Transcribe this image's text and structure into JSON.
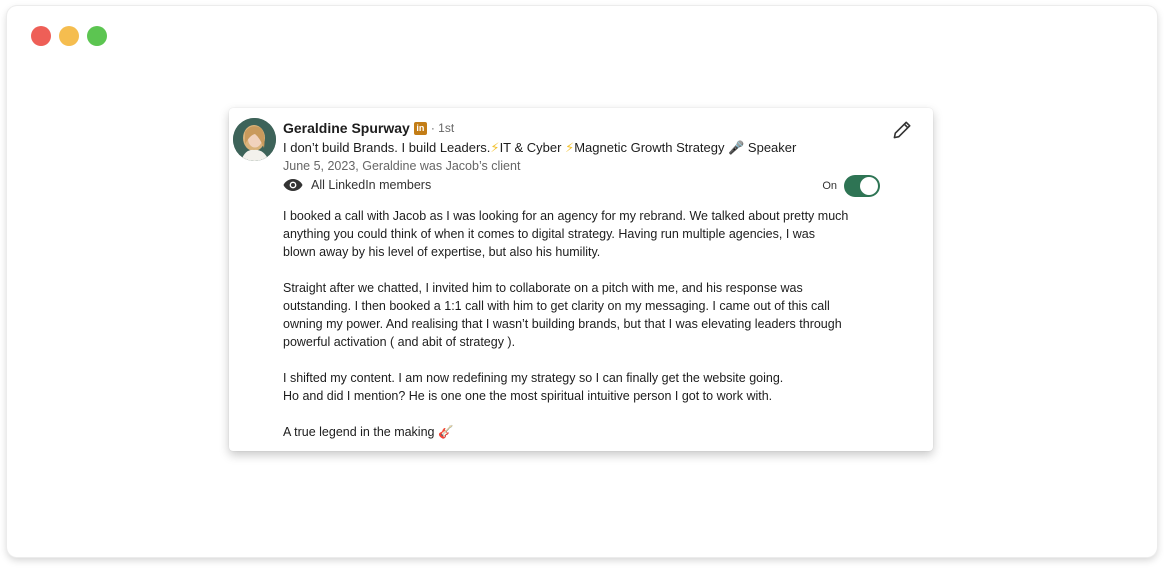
{
  "window": {
    "controls": [
      "close",
      "minimize",
      "zoom"
    ]
  },
  "recommendation": {
    "author": {
      "name": "Geraldine Spurway",
      "network_badge": "in",
      "degree": "· 1st",
      "headline_parts": [
        "I don’t build Brands. I build Leaders.",
        "⚡",
        "IT & Cyber ",
        "⚡",
        "Magnetic Growth Strategy 🎤 Speaker"
      ]
    },
    "meta": "June 5, 2023, Geraldine was Jacob’s client",
    "visibility": {
      "icon": "eye-icon",
      "label": "All LinkedIn members"
    },
    "toggle": {
      "label": "On",
      "state": "on",
      "color": "#2e7454"
    },
    "edit_icon": "pencil-icon",
    "paragraphs": [
      [
        "I booked a call with Jacob as I was looking for an agency for my rebrand. We talked about pretty much",
        "anything you could think of when it comes to digital strategy. Having run multiple agencies, I was",
        "blown away by his level of expertise, but also his humility."
      ],
      [
        "Straight after we chatted, I invited him to collaborate on a pitch with me, and his response was",
        "outstanding. I then booked a 1:1 call with him to get clarity on my messaging. I came out of this call",
        "owning my power. And realising that I wasn’t building brands, but that I was elevating leaders through",
        "powerful activation ( and abit of strategy )."
      ],
      [
        "I shifted my content. I am now redefining my strategy so I can finally get the website going.",
        "Ho and did I mention? He is one one the most spiritual intuitive person I got to work with."
      ],
      [
        "A true legend in the making 🎸"
      ]
    ]
  }
}
